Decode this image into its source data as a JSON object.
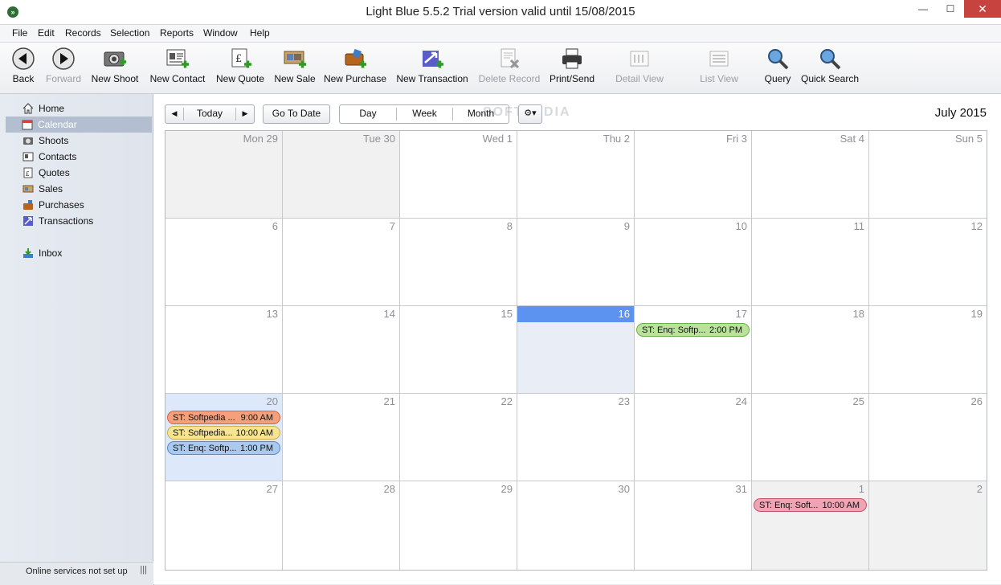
{
  "window": {
    "title": "Light Blue 5.5.2    Trial version valid until 15/08/2015",
    "app_icon": "»",
    "min_glyph": "—",
    "max_glyph": "☐",
    "close_glyph": "✕"
  },
  "menu": [
    "File",
    "Edit",
    "Records",
    "Selection",
    "Reports",
    "Window",
    "Help"
  ],
  "toolbar": {
    "back": "Back",
    "forward": "Forward",
    "new_shoot": "New Shoot",
    "new_contact": "New Contact",
    "new_quote": "New Quote",
    "new_sale": "New Sale",
    "new_purchase": "New Purchase",
    "new_transaction": "New Transaction",
    "delete_record": "Delete Record",
    "print_send": "Print/Send",
    "detail_view": "Detail View",
    "list_view": "List View",
    "query": "Query",
    "quick_search": "Quick Search"
  },
  "sidebar": {
    "items": [
      {
        "label": "Home",
        "icon": "home-icon"
      },
      {
        "label": "Calendar",
        "icon": "calendar-icon"
      },
      {
        "label": "Shoots",
        "icon": "camera-icon"
      },
      {
        "label": "Contacts",
        "icon": "contact-card-icon"
      },
      {
        "label": "Quotes",
        "icon": "quote-icon"
      },
      {
        "label": "Sales",
        "icon": "sale-icon"
      },
      {
        "label": "Purchases",
        "icon": "purchase-icon"
      },
      {
        "label": "Transactions",
        "icon": "transaction-icon"
      },
      {
        "label": "Inbox",
        "icon": "inbox-icon"
      }
    ],
    "active": "Calendar",
    "status": "Online services not set up",
    "status_grip": "|||"
  },
  "calendar": {
    "controls": {
      "prev": "◀",
      "today": "Today",
      "next": "▶",
      "go_to_date": "Go To Date",
      "day": "Day",
      "week": "Week",
      "month": "Month",
      "settings_glyph": "⚙▾"
    },
    "watermark": "SOFTPEDIA",
    "month_title": "July 2015",
    "weeks": [
      [
        "Mon 29",
        "Tue 30",
        "Wed 1",
        "Thu 2",
        "Fri 3",
        "Sat 4",
        "Sun 5"
      ],
      [
        "6",
        "7",
        "8",
        "9",
        "10",
        "11",
        "12"
      ],
      [
        "13",
        "14",
        "15",
        "16",
        "17",
        "18",
        "19"
      ],
      [
        "20",
        "21",
        "22",
        "23",
        "24",
        "25",
        "26"
      ],
      [
        "27",
        "28",
        "29",
        "30",
        "31",
        "1",
        "2"
      ]
    ],
    "events": [
      {
        "week": 2,
        "day": 4,
        "slot": 0,
        "title": "ST: Enq: Softp...",
        "time": "2:00 PM",
        "color": "#b9e39a",
        "border": "#6fae4f"
      },
      {
        "week": 3,
        "day": 0,
        "slot": 0,
        "title": "ST: Softpedia ...",
        "time": "9:00 AM",
        "color": "#f5a07a",
        "border": "#d3653b"
      },
      {
        "week": 3,
        "day": 0,
        "slot": 1,
        "title": "ST: Softpedia...",
        "time": "10:00 AM",
        "color": "#f7e48f",
        "border": "#cdb14c"
      },
      {
        "week": 3,
        "day": 0,
        "slot": 2,
        "title": "ST: Enq: Softp...",
        "time": "1:00 PM",
        "color": "#a9c9ef",
        "border": "#5d89c3"
      },
      {
        "week": 4,
        "day": 5,
        "slot": 0,
        "title": "ST: Enq: Soft...",
        "time": "10:00 AM",
        "color": "#f0a4b3",
        "border": "#c0586d"
      }
    ]
  }
}
